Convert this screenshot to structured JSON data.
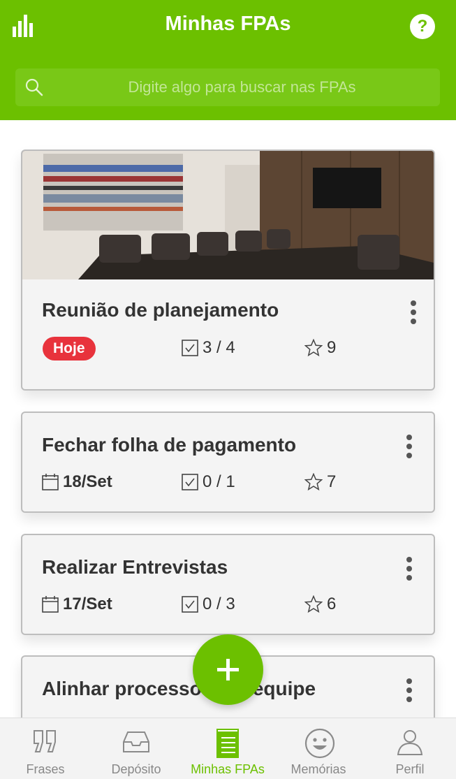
{
  "header": {
    "title": "Minhas FPAs",
    "help_label": "?",
    "search_placeholder": "Digite algo para buscar nas FPAs"
  },
  "colors": {
    "brand": "#6cc000",
    "badge_today": "#e8333c"
  },
  "cards": [
    {
      "title": "Reunião de planejamento",
      "date": "Hoje",
      "date_is_badge": true,
      "tasks": "3 / 4",
      "stars": "9",
      "has_photo": true
    },
    {
      "title": "Fechar folha de pagamento",
      "date": "18/Set",
      "tasks": "0 / 1",
      "stars": "7"
    },
    {
      "title": "Realizar Entrevistas",
      "date": "17/Set",
      "tasks": "0 / 3",
      "stars": "6"
    },
    {
      "title": "Alinhar processo com equipe"
    }
  ],
  "fab": {
    "icon": "plus-icon"
  },
  "nav": [
    {
      "label": "Frases",
      "icon": "quote-icon"
    },
    {
      "label": "Depósito",
      "icon": "inbox-icon"
    },
    {
      "label": "Minhas FPAs",
      "icon": "notepad-icon",
      "active": true
    },
    {
      "label": "Memórias",
      "icon": "smiley-icon"
    },
    {
      "label": "Perfil",
      "icon": "user-icon"
    }
  ]
}
